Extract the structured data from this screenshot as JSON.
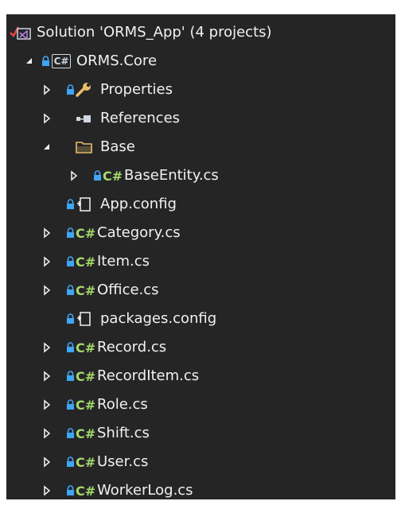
{
  "colors": {
    "background": "#252526",
    "text": "#f1f1f1",
    "csharp_icon": "#a6d96a",
    "lock_icon": "#3fa5f5",
    "vs_icon": "#b180d7",
    "checkmark": "#e04545"
  },
  "solution": {
    "label": "Solution 'ORMS_App' (4 projects)",
    "icon": "vs-solution-icon"
  },
  "project": {
    "label": "ORMS.Core",
    "icon_text": "C#",
    "expanded": true
  },
  "csharp_glyph": "C#",
  "items": [
    {
      "label": "Properties",
      "icon": "wrench-icon",
      "has_arrow": true,
      "arrow": "collapsed",
      "locked": true
    },
    {
      "label": "References",
      "icon": "references-icon",
      "has_arrow": true,
      "arrow": "collapsed",
      "locked": false
    },
    {
      "label": "Base",
      "icon": "folder-icon",
      "has_arrow": true,
      "arrow": "expanded",
      "locked": false
    },
    {
      "label": "BaseEntity.cs",
      "icon": "csharp-file-icon",
      "has_arrow": true,
      "arrow": "collapsed",
      "locked": true,
      "nested": true
    },
    {
      "label": "App.config",
      "icon": "config-file-icon",
      "has_arrow": false,
      "locked": true
    },
    {
      "label": "Category.cs",
      "icon": "csharp-file-icon",
      "has_arrow": true,
      "arrow": "collapsed",
      "locked": true
    },
    {
      "label": "Item.cs",
      "icon": "csharp-file-icon",
      "has_arrow": true,
      "arrow": "collapsed",
      "locked": true
    },
    {
      "label": "Office.cs",
      "icon": "csharp-file-icon",
      "has_arrow": true,
      "arrow": "collapsed",
      "locked": true
    },
    {
      "label": "packages.config",
      "icon": "config-file-icon",
      "has_arrow": false,
      "locked": true
    },
    {
      "label": "Record.cs",
      "icon": "csharp-file-icon",
      "has_arrow": true,
      "arrow": "collapsed",
      "locked": true
    },
    {
      "label": "RecordItem.cs",
      "icon": "csharp-file-icon",
      "has_arrow": true,
      "arrow": "collapsed",
      "locked": true
    },
    {
      "label": "Role.cs",
      "icon": "csharp-file-icon",
      "has_arrow": true,
      "arrow": "collapsed",
      "locked": true
    },
    {
      "label": "Shift.cs",
      "icon": "csharp-file-icon",
      "has_arrow": true,
      "arrow": "collapsed",
      "locked": true
    },
    {
      "label": "User.cs",
      "icon": "csharp-file-icon",
      "has_arrow": true,
      "arrow": "collapsed",
      "locked": true
    },
    {
      "label": "WorkerLog.cs",
      "icon": "csharp-file-icon",
      "has_arrow": true,
      "arrow": "collapsed",
      "locked": true
    }
  ]
}
